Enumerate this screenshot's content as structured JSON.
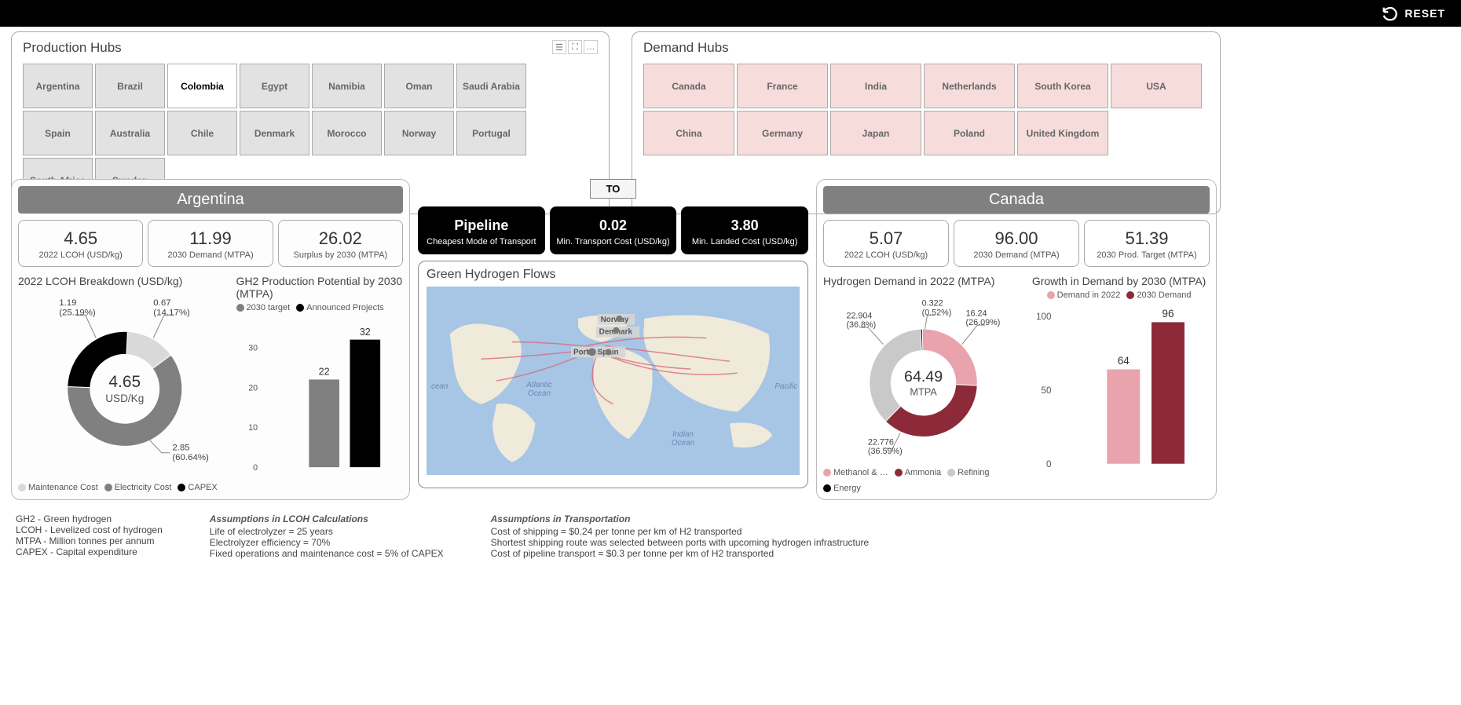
{
  "reset_label": "RESET",
  "panels": {
    "production": {
      "title": "Production Hubs"
    },
    "demand_hubs": {
      "title": "Demand Hubs"
    }
  },
  "production_hubs": [
    "Argentina",
    "Brazil",
    "Colombia",
    "Egypt",
    "Namibia",
    "Oman",
    "Saudi Arabia",
    "Spain",
    "Australia",
    "Chile",
    "Denmark",
    "Morocco",
    "Norway",
    "Portugal",
    "South Africa",
    "Sweden"
  ],
  "selected_production_hub": "Colombia",
  "demand_hubs_list": [
    "Canada",
    "France",
    "India",
    "Netherlands",
    "South Korea",
    "USA",
    "China",
    "Germany",
    "Japan",
    "Poland",
    "United Kingdom"
  ],
  "production_detail": {
    "name": "Argentina",
    "kpis": [
      {
        "value": "4.65",
        "label": "2022 LCOH (USD/kg)"
      },
      {
        "value": "11.99",
        "label": "2030 Demand (MTPA)"
      },
      {
        "value": "26.02",
        "label": "Surplus by 2030 (MTPA)"
      }
    ]
  },
  "to_label": "TO",
  "transport_kpis": [
    {
      "value": "Pipeline",
      "label": "Cheapest Mode of Transport"
    },
    {
      "value": "0.02",
      "label": "Min. Transport Cost (USD/kg)"
    },
    {
      "value": "3.80",
      "label": "Min. Landed Cost (USD/kg)"
    }
  ],
  "map_title": "Green Hydrogen Flows",
  "map_labels": {
    "atlantic": "Atlantic Ocean",
    "indian": "Indian Ocean",
    "pacific": "Pacific O",
    "ocean_left": "cean"
  },
  "map_country_labels": [
    "Norway",
    "Denmark",
    "Portugal",
    "Spain"
  ],
  "demand_detail": {
    "name": "Canada",
    "kpis": [
      {
        "value": "5.07",
        "label": "2022 LCOH (USD/kg)"
      },
      {
        "value": "96.00",
        "label": "2030 Demand (MTPA)"
      },
      {
        "value": "51.39",
        "label": "2030 Prod. Target (MTPA)"
      }
    ]
  },
  "lcoh_breakdown_title": "2022 LCOH Breakdown (USD/kg)",
  "gh2_potential_title": "GH2 Production Potential by 2030 (MTPA)",
  "demand_donut_title": "Hydrogen Demand in 2022 (MTPA)",
  "growth_bar_title": "Growth in Demand by 2030 (MTPA)",
  "lcoh_legend": [
    {
      "label": "Maintenance Cost",
      "color": "#d9d9d9"
    },
    {
      "label": "Electricity Cost",
      "color": "#808080"
    },
    {
      "label": "CAPEX",
      "color": "#000000"
    }
  ],
  "gh2_legend": [
    {
      "label": "2030 target",
      "color": "#808080"
    },
    {
      "label": "Announced Projects",
      "color": "#000000"
    }
  ],
  "demand_donut_legend": [
    {
      "label": "Methanol & …",
      "color": "#e9a3ad"
    },
    {
      "label": "Ammonia",
      "color": "#8c2a3a"
    },
    {
      "label": "Refining",
      "color": "#c9c9c9"
    },
    {
      "label": "Energy",
      "color": "#000000"
    }
  ],
  "growth_legend": [
    {
      "label": "Demand in 2022",
      "color": "#e9a3ad"
    },
    {
      "label": "2030 Demand",
      "color": "#8c2a3a"
    }
  ],
  "footer": {
    "defs": [
      "GH2 - Green hydrogen",
      "LCOH - Levelized cost of hydrogen",
      "MTPA - Million tonnes per annum",
      "CAPEX - Capital expenditure"
    ],
    "lcoh_head": "Assumptions in LCOH Calculations",
    "lcoh_lines": [
      "Life of electrolyzer = 25 years",
      "Electrolyzer efficiency = 70%",
      "Fixed operations and maintenance cost = 5% of CAPEX"
    ],
    "trans_head": "Assumptions in Transportation",
    "trans_lines": [
      "Cost of shipping = $0.24 per tonne per km of H2 transported",
      "Shortest shipping route was selected between ports with upcoming hydrogen infrastructure",
      "Cost of pipeline transport = $0.3 per tonne per km of H2 transported"
    ]
  },
  "chart_data": [
    {
      "type": "pie",
      "title": "2022 LCOH Breakdown (USD/kg)",
      "series": [
        {
          "name": "Maintenance Cost",
          "value": 0.67,
          "pct": 14.17,
          "color": "#d9d9d9"
        },
        {
          "name": "Electricity Cost",
          "value": 2.85,
          "pct": 60.64,
          "color": "#808080"
        },
        {
          "name": "CAPEX",
          "value": 1.19,
          "pct": 25.19,
          "color": "#000000"
        }
      ],
      "center_value": "4.65",
      "center_unit": "USD/Kg"
    },
    {
      "type": "bar",
      "title": "GH2 Production Potential by 2030 (MTPA)",
      "categories": [
        "2030 target",
        "Announced Projects"
      ],
      "values": [
        22,
        32
      ],
      "colors": [
        "#808080",
        "#000000"
      ],
      "ylim": [
        0,
        35
      ],
      "yticks": [
        0,
        10,
        20,
        30
      ],
      "ylabel": "",
      "xlabel": ""
    },
    {
      "type": "pie",
      "title": "Hydrogen Demand in 2022 (MTPA)",
      "series": [
        {
          "name": "Methanol & …",
          "value": 16.24,
          "pct": 26.09,
          "color": "#e9a3ad"
        },
        {
          "name": "Ammonia",
          "value": 22.776,
          "pct": 36.59,
          "color": "#8c2a3a"
        },
        {
          "name": "Refining",
          "value": 22.904,
          "pct": 36.8,
          "color": "#c9c9c9"
        },
        {
          "name": "Energy",
          "value": 0.322,
          "pct": 0.52,
          "color": "#000000"
        }
      ],
      "center_value": "64.49",
      "center_unit": "MTPA"
    },
    {
      "type": "bar",
      "title": "Growth in Demand by 2030 (MTPA)",
      "categories": [
        "Demand in 2022",
        "2030 Demand"
      ],
      "values": [
        64,
        96
      ],
      "colors": [
        "#e9a3ad",
        "#8c2a3a"
      ],
      "ylim": [
        0,
        100
      ],
      "yticks": [
        0,
        50,
        100
      ],
      "ylabel": "",
      "xlabel": ""
    }
  ]
}
